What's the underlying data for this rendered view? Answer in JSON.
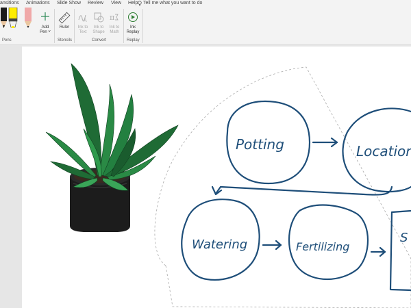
{
  "tabs": [
    "ansitions",
    "Animations",
    "Slide Show",
    "Review",
    "View",
    "Help"
  ],
  "tell_me": {
    "placeholder": "Tell me what you want to do"
  },
  "ribbon": {
    "pens_group": {
      "label": "Pens",
      "add_pen": "Add\nPen",
      "add_pen_line1": "Add",
      "add_pen_line2": "Pen ˅"
    },
    "stencils_group": {
      "label": "Stencils",
      "ruler": "Ruler"
    },
    "convert_group": {
      "label": "Convert",
      "ink_to_text": [
        "Ink to",
        "Text"
      ],
      "ink_to_shape": [
        "Ink to",
        "Shape"
      ],
      "ink_to_math": [
        "Ink to",
        "Math"
      ]
    },
    "replay_group": {
      "label": "Replay",
      "ink_replay": [
        "Ink",
        "Replay"
      ]
    }
  },
  "pen_colors": [
    "#ffec00",
    "#f0a8a8"
  ],
  "accent": "#1e4e79",
  "diagram": {
    "nodes": [
      "Potting",
      "Location",
      "Watering",
      "Fertilizing",
      "S s"
    ]
  }
}
